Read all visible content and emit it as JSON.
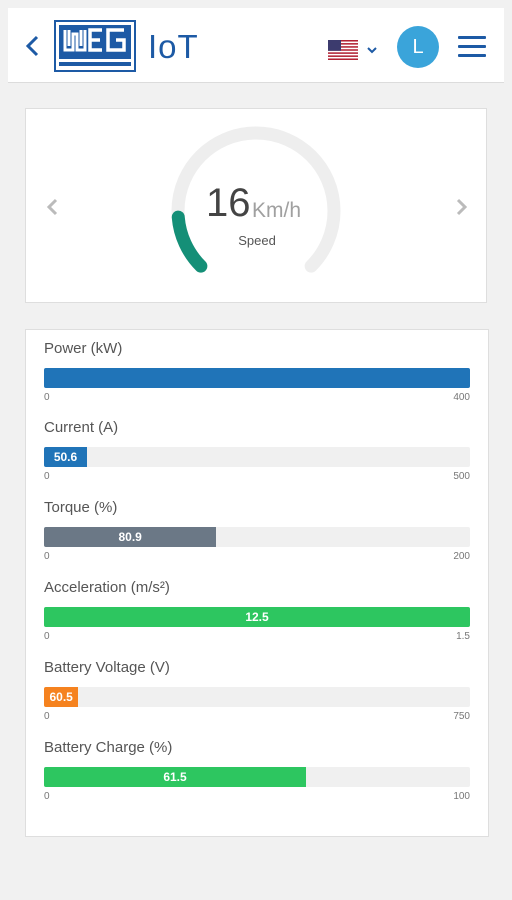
{
  "header": {
    "brand_logo_text": "WEG",
    "brand_text": "IoT",
    "user_initial": "L",
    "language_flag": "us-flag-icon",
    "colors": {
      "brand": "#1d5aa5",
      "avatar": "#3aa4da"
    }
  },
  "gauge": {
    "value": "16",
    "unit": "Km/h",
    "label": "Speed",
    "fraction": 0.15,
    "colors": {
      "arc": "#148f77",
      "track": "#eeeeee"
    }
  },
  "metrics": [
    {
      "label": "Power (kW)",
      "value": "",
      "min": "0",
      "max": "400",
      "fraction": 1.0,
      "color": "#2074b8"
    },
    {
      "label": "Current (A)",
      "value": "50.6",
      "min": "0",
      "max": "500",
      "fraction": 0.101,
      "color": "#2074b8"
    },
    {
      "label": "Torque (%)",
      "value": "80.9",
      "min": "0",
      "max": "200",
      "fraction": 0.4045,
      "color": "#6b7886"
    },
    {
      "label": "Acceleration (m/s²)",
      "value": "12.5",
      "min": "0",
      "max": "1.5",
      "fraction": 1.0,
      "color": "#2dc660"
    },
    {
      "label": "Battery Voltage (V)",
      "value": "60.5",
      "min": "0",
      "max": "750",
      "fraction": 0.0807,
      "color": "#f5821f"
    },
    {
      "label": "Battery Charge (%)",
      "value": "61.5",
      "min": "0",
      "max": "100",
      "fraction": 0.615,
      "color": "#2dc660"
    }
  ]
}
